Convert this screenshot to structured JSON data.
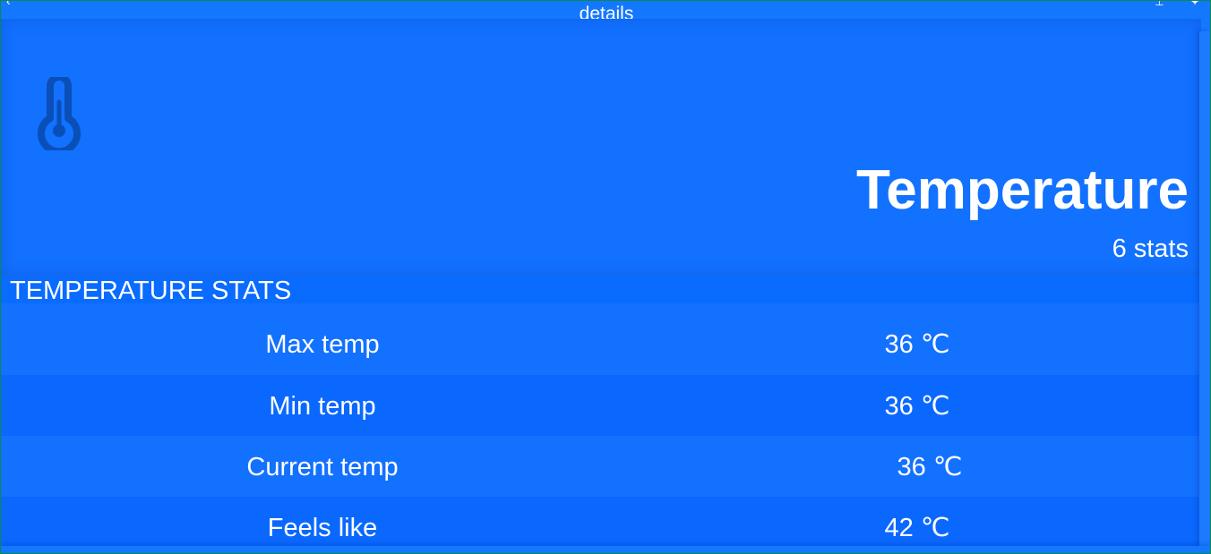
{
  "window": {
    "title": "details"
  },
  "header": {
    "icon": "thermometer-icon",
    "title": "Temperature",
    "subtitle": "6 stats"
  },
  "section": {
    "title": "TEMPERATURE STATS"
  },
  "stats": [
    {
      "label": "Max temp",
      "value": "36 ℃"
    },
    {
      "label": "Min temp",
      "value": "36 ℃"
    },
    {
      "label": "Current temp",
      "value": "36 ℃"
    },
    {
      "label": "Feels like",
      "value": "42 ℃"
    }
  ],
  "colors": {
    "background": "#1478ff",
    "row_alt": "#0a68ff",
    "icon": "#0a4fb8",
    "text": "#ffffff"
  }
}
